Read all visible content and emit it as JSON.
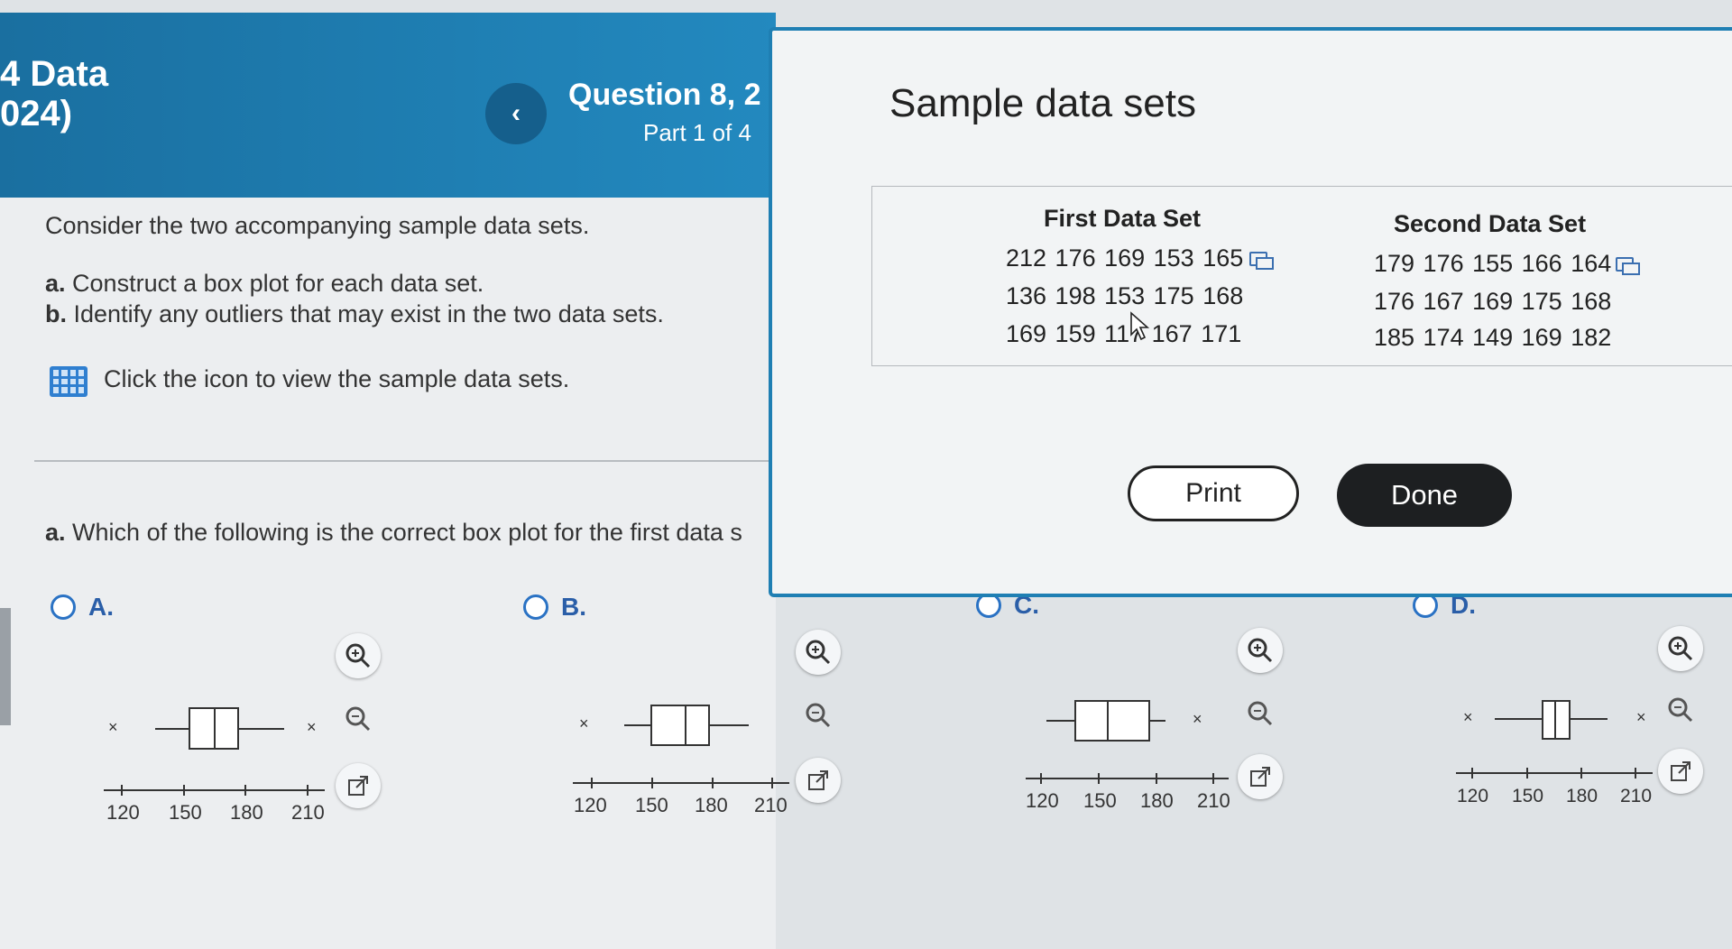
{
  "header": {
    "course_title_line1": "4 Data",
    "course_title_line2": "024)",
    "back_label": "‹",
    "question_title": "Question 8, 2",
    "part_label": "Part 1 of 4"
  },
  "question": {
    "intro": "Consider the two accompanying sample data sets.",
    "item_a_label": "a.",
    "item_a": "Construct a box plot for each data set.",
    "item_b_label": "b.",
    "item_b": "Identify any outliers that may exist in the two data sets.",
    "icon_prompt": "Click the icon to view the sample data sets.",
    "sub_question_label": "a.",
    "sub_question": "Which of the following is the correct box plot for the first data s"
  },
  "options": [
    {
      "letter": "A.",
      "axis_ticks": [
        "120",
        "150",
        "180",
        "210"
      ]
    },
    {
      "letter": "B.",
      "axis_ticks": [
        "120",
        "150",
        "180",
        "210"
      ]
    },
    {
      "letter": "C.",
      "axis_ticks": [
        "120",
        "150",
        "180",
        "210"
      ]
    },
    {
      "letter": "D.",
      "axis_ticks": [
        "120",
        "150",
        "180",
        "210"
      ]
    }
  ],
  "modal": {
    "title": "Sample data sets",
    "first_heading": "First Data Set",
    "second_heading": "Second Data Set",
    "first_rows": [
      "212 176 169 153 165",
      "136 198 153 175 168",
      "169 159 117 167 171"
    ],
    "second_rows": [
      "179 176 155 166 164",
      "176 167 169 175 168",
      "185 174 149 169 182"
    ],
    "print_label": "Print",
    "done_label": "Done"
  },
  "colors": {
    "header_blue": "#1f7fb3",
    "radio_blue": "#2a72c4",
    "done_button": "#1d1f21"
  }
}
